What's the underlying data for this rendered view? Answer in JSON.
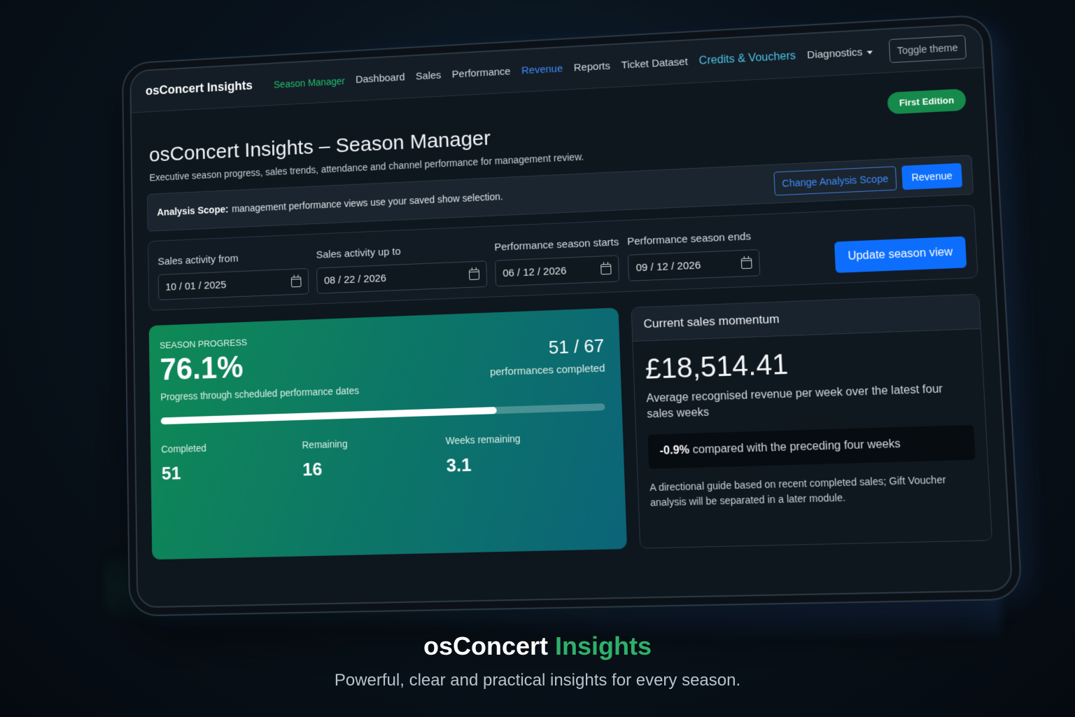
{
  "app": {
    "brand": "osConcert Insights",
    "nav": [
      {
        "label": "Season Manager",
        "style": "active"
      },
      {
        "label": "Dashboard",
        "style": ""
      },
      {
        "label": "Sales",
        "style": ""
      },
      {
        "label": "Performance",
        "style": ""
      },
      {
        "label": "Revenue",
        "style": "blue"
      },
      {
        "label": "Reports",
        "style": ""
      },
      {
        "label": "Ticket Dataset",
        "style": ""
      },
      {
        "label": "Credits & Vouchers",
        "style": "teal"
      },
      {
        "label": "Diagnostics",
        "style": "dd"
      }
    ],
    "toggle_theme": "Toggle theme"
  },
  "page": {
    "badge": "First Edition",
    "title": "osConcert Insights – Season Manager",
    "subtitle": "Executive season progress, sales trends, attendance and channel performance for management review."
  },
  "scope": {
    "label": "Analysis Scope:",
    "text": "management performance views use your saved show selection.",
    "change_button": "Change Analysis Scope",
    "revenue_button": "Revenue"
  },
  "filters": {
    "sales_from": {
      "label": "Sales activity from",
      "value": "10 / 01 / 2025"
    },
    "sales_to": {
      "label": "Sales activity up to",
      "value": "08 / 22 / 2026"
    },
    "season_starts": {
      "label": "Performance season starts",
      "value": "06 / 12 / 2026"
    },
    "season_ends": {
      "label": "Performance season ends",
      "value": "09 / 12 / 2026"
    },
    "update_button": "Update season view"
  },
  "progress": {
    "label": "Season Progress",
    "percent": "76.1%",
    "percent_value": 0.761,
    "description": "Progress through scheduled performance dates",
    "count": "51 / 67",
    "count_label": "performances completed",
    "stats": [
      {
        "label": "Completed",
        "value": "51"
      },
      {
        "label": "Remaining",
        "value": "16"
      },
      {
        "label": "Weeks remaining",
        "value": "3.1"
      }
    ]
  },
  "momentum": {
    "title": "Current sales momentum",
    "amount": "£18,514.41",
    "description": "Average recognised revenue per week over the latest four sales weeks",
    "change_value": "-0.9%",
    "change_text": "compared with the preceding four weeks",
    "note": "A directional guide based on recent completed sales; Gift Voucher analysis will be separated in a later module."
  },
  "footer": {
    "title_main": "osConcert",
    "title_accent": "Insights",
    "tagline": "Powerful, clear and practical insights for every season."
  },
  "colors": {
    "accent_green": "#1fbf6e",
    "primary_blue": "#0d6efd",
    "card_gradient_start": "#0f8a55",
    "card_gradient_end": "#0b6478"
  }
}
